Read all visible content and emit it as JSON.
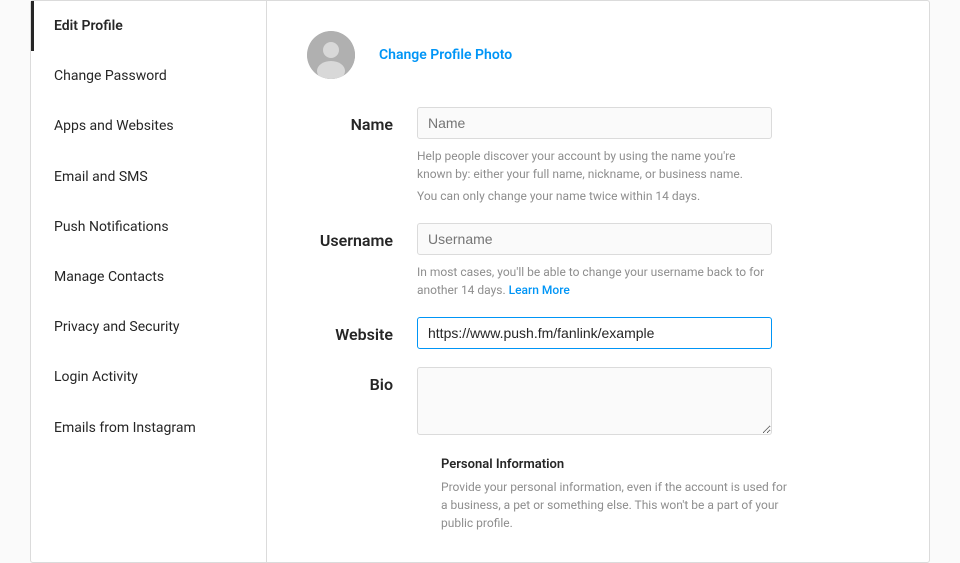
{
  "sidebar": {
    "items": [
      {
        "id": "edit-profile",
        "label": "Edit Profile",
        "active": true
      },
      {
        "id": "change-password",
        "label": "Change Password",
        "active": false
      },
      {
        "id": "apps-websites",
        "label": "Apps and Websites",
        "active": false
      },
      {
        "id": "email-sms",
        "label": "Email and SMS",
        "active": false
      },
      {
        "id": "push-notifications",
        "label": "Push Notifications",
        "active": false
      },
      {
        "id": "manage-contacts",
        "label": "Manage Contacts",
        "active": false
      },
      {
        "id": "privacy-security",
        "label": "Privacy and Security",
        "active": false
      },
      {
        "id": "login-activity",
        "label": "Login Activity",
        "active": false
      },
      {
        "id": "emails-instagram",
        "label": "Emails from Instagram",
        "active": false
      }
    ]
  },
  "main": {
    "change_photo_label": "Change Profile Photo",
    "fields": {
      "name": {
        "label": "Name",
        "placeholder": "Name",
        "value": "",
        "hint1": "Help people discover your account by using the name you're known by: either your full name, nickname, or business name.",
        "hint2": "You can only change your name twice within 14 days."
      },
      "username": {
        "label": "Username",
        "placeholder": "Username",
        "value": "",
        "hint": "In most cases, you'll be able to change your username back to for another 14 days.",
        "hint_link": "Learn More"
      },
      "website": {
        "label": "Website",
        "placeholder": "",
        "value": "https://www.push.fm/fanlink/example"
      },
      "bio": {
        "label": "Bio",
        "placeholder": "",
        "value": ""
      }
    },
    "personal_info": {
      "title": "Personal Information",
      "description": "Provide your personal information, even if the account is used for a business, a pet or something else. This won't be a part of your public profile."
    }
  }
}
